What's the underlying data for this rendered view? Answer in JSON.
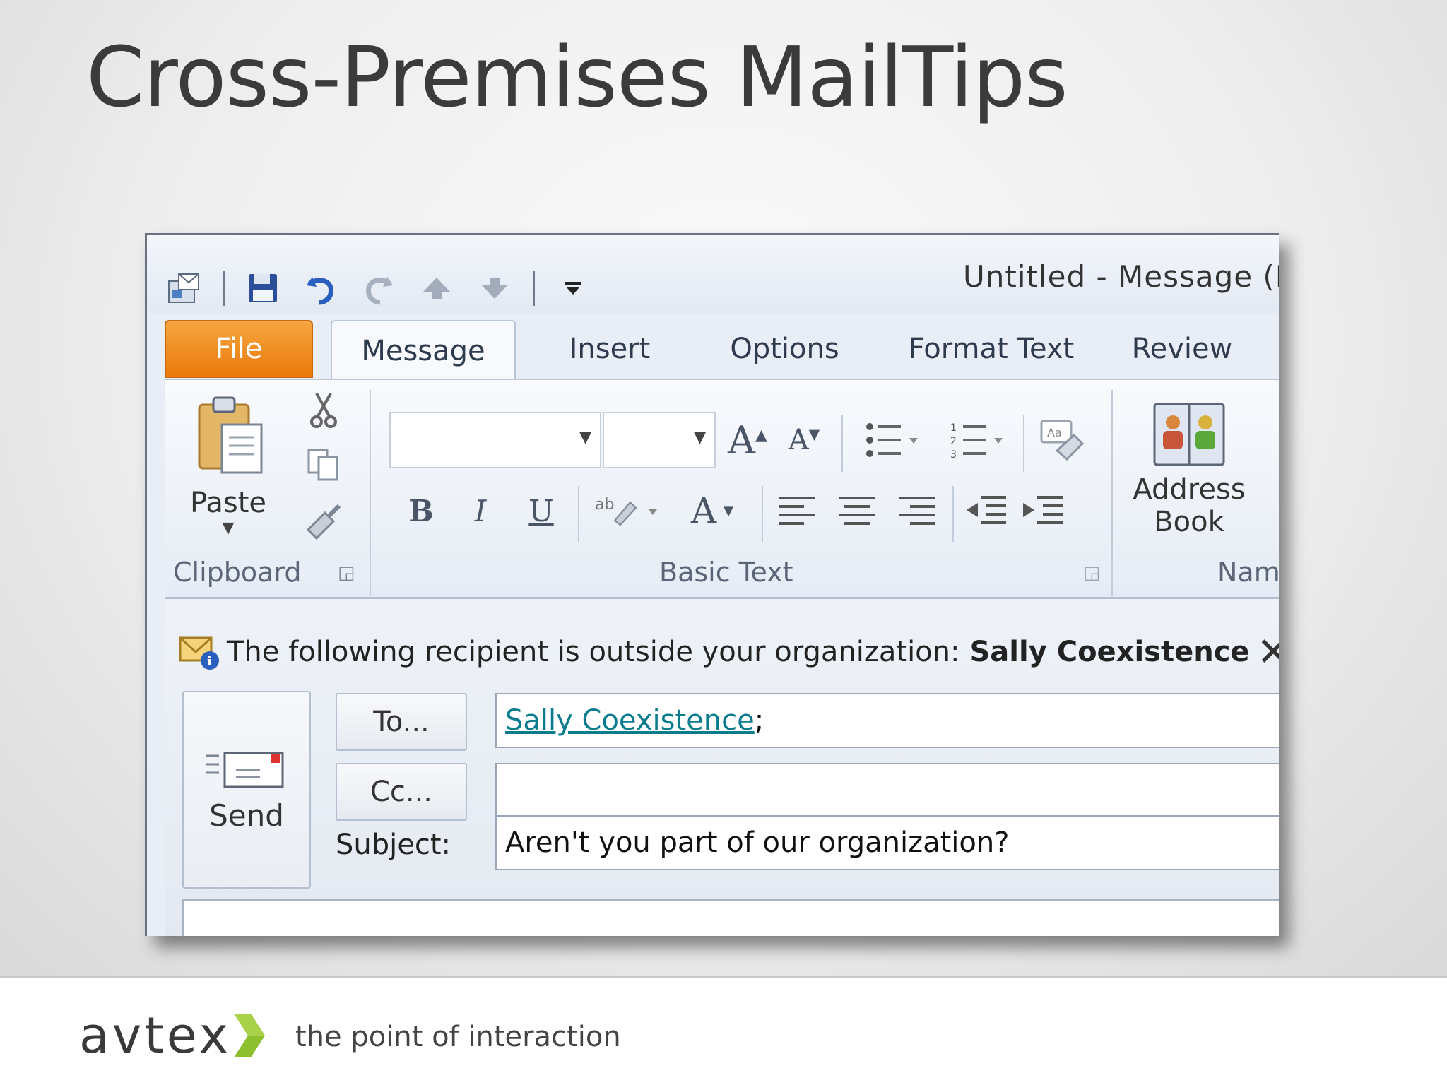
{
  "slide": {
    "title": "Cross-Premises MailTips"
  },
  "window": {
    "title": "Untitled  -  Message (H"
  },
  "tabs": [
    {
      "label": "File"
    },
    {
      "label": "Message"
    },
    {
      "label": "Insert"
    },
    {
      "label": "Options"
    },
    {
      "label": "Format Text"
    },
    {
      "label": "Review"
    }
  ],
  "ribbon": {
    "paste_label": "Paste",
    "address_book_line1": "Address",
    "address_book_line2": "Book",
    "groups": {
      "clipboard": "Clipboard",
      "basic_text": "Basic Text",
      "names": "Nam"
    }
  },
  "mailtip": {
    "text": "The following recipient is outside your organization:",
    "recipient": "Sally Coexistence"
  },
  "compose": {
    "send_label": "Send",
    "to_button": "To...",
    "cc_button": "Cc...",
    "subject_label": "Subject:",
    "to_recipient": "Sally Coexistence",
    "to_suffix": ";",
    "cc_value": "",
    "subject_value": "Aren't you part of our organization?"
  },
  "footer": {
    "logo": "avtex",
    "tagline": "the point of interaction"
  },
  "colors": {
    "file_tab": "#e9790b",
    "link": "#0b7c8f",
    "logo_chevron": "#8dbf2e"
  }
}
